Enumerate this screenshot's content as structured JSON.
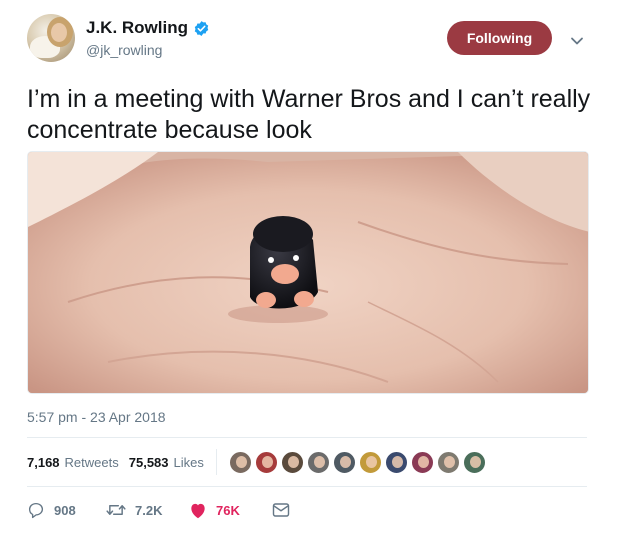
{
  "author": {
    "display_name": "J.K. Rowling",
    "handle": "@jk_rowling",
    "verified_icon": "verified-badge-icon",
    "avatar_icon": "profile-avatar"
  },
  "follow_button": {
    "label": "Following",
    "color": "#9b3a42"
  },
  "menu_icon": "chevron-down-icon",
  "tweet": {
    "text": "I’m in a meeting with Warner Bros and I can’t really concentrate because look",
    "photo": "niffler-figure-in-palm"
  },
  "timestamp": "5:57 pm - 23 Apr 2018",
  "stats": {
    "retweets_count": "7,168",
    "retweets_label": "Retweets",
    "likes_count": "75,583",
    "likes_label": "Likes",
    "liker_avatars": [
      {
        "color": "#7a6a60"
      },
      {
        "color": "#a63b3b"
      },
      {
        "color": "#5a4a3c"
      },
      {
        "color": "#6b6b6b"
      },
      {
        "color": "#4f5a63"
      },
      {
        "color": "#c29a3a"
      },
      {
        "color": "#3a4a6e"
      },
      {
        "color": "#8a3a55"
      },
      {
        "color": "#7e7a70"
      },
      {
        "color": "#4a6e5a"
      }
    ]
  },
  "actions": {
    "reply_count": "908",
    "retweet_count": "7.2K",
    "like_count": "76K",
    "like_color": "#e0245e"
  }
}
